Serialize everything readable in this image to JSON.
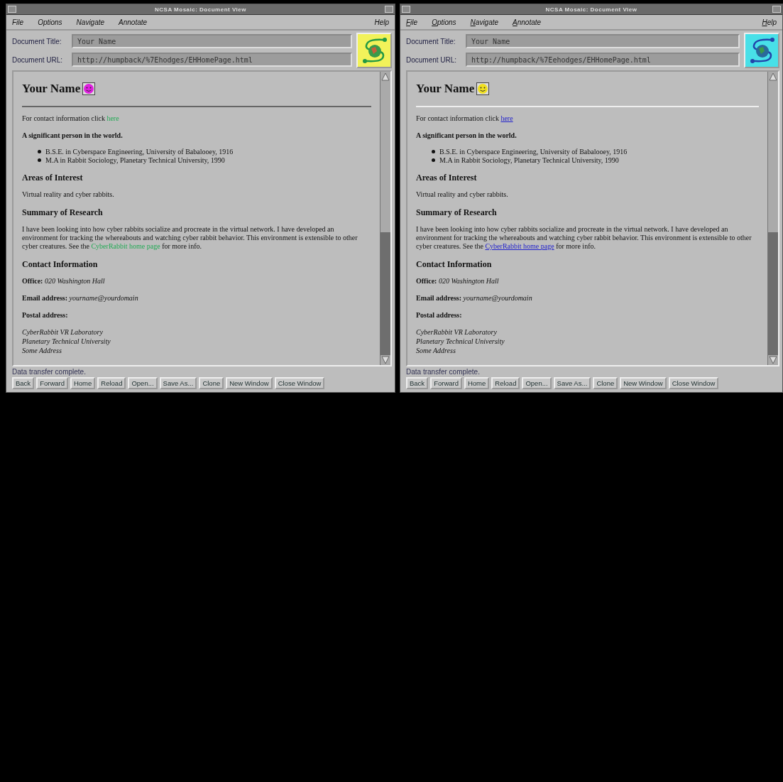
{
  "windows": [
    {
      "title": "NCSA Mosaic: Document View",
      "menu_mnemonics": false,
      "links_underlined": false,
      "menus": [
        {
          "label": "File"
        },
        {
          "label": "Options"
        },
        {
          "label": "Navigate"
        },
        {
          "label": "Annotate"
        }
      ],
      "help": "Help",
      "doc_title_label": "Document Title:",
      "doc_title": "Your Name",
      "doc_url_label": "Document URL:",
      "doc_url": "http://humpback/%7Ehodges/EHHomePage.html",
      "logo": {
        "color": "#f2f25a"
      },
      "content": [
        {
          "kind": "h1",
          "text": "Your Name",
          "color": "#e020e0"
        },
        {
          "kind": "rule"
        },
        {
          "kind": "para",
          "before": "For contact information click ",
          "link": "here"
        },
        {
          "kind": "bold",
          "text": "A significant person in the world."
        },
        {
          "kind": "list",
          "items": [
            "B.S.E. in Cyberspace Engineering, University of Babalooey, 1916",
            "M.A in Rabbit Sociology, Planetary Technical University, 1990"
          ]
        },
        {
          "kind": "h2",
          "text": "Areas of Interest"
        },
        {
          "kind": "para",
          "before": "Virtual reality and cyber rabbits."
        },
        {
          "kind": "h2",
          "text": "Summary of Research"
        },
        {
          "kind": "para",
          "before": "I have been looking into how cyber rabbits socialize and procreate in the virtual network. I have developed an environment for tracking the whereabouts and watching cyber rabbit behavior. This environment is extensible to other cyber creatures. See the ",
          "link": "CyberRabbit home page",
          "after": " for more info."
        },
        {
          "kind": "h2",
          "text": "Contact Information"
        },
        {
          "kind": "rich",
          "text": "**Office:** *020 Washington Hall*"
        },
        {
          "kind": "rich",
          "text": "**Email address:** *yourname@yourdomain*"
        },
        {
          "kind": "bold",
          "text": "Postal address:"
        },
        {
          "kind": "address",
          "lines": [
            "CyberRabbit VR Laboratory",
            "Planetary Technical University",
            "Some Address"
          ]
        }
      ],
      "status": "Data transfer complete.",
      "buttons": [
        "Back",
        "Forward",
        "Home",
        "Reload",
        "Open...",
        "Save As...",
        "Clone",
        "New Window",
        "Close Window"
      ]
    },
    {
      "title": "NCSA Mosaic: Document View",
      "menu_mnemonics": true,
      "links_underlined": true,
      "menus": [
        {
          "label": "File"
        },
        {
          "label": "Options"
        },
        {
          "label": "Navigate"
        },
        {
          "label": "Annotate"
        }
      ],
      "help": "Help",
      "doc_title_label": "Document Title:",
      "doc_title": "Your Name",
      "doc_url_label": "Document URL:",
      "doc_url": "http://humpback/%7Eehodges/EHHomePage.html",
      "logo": {
        "color": "#48e0e8"
      },
      "content": [
        {
          "kind": "h1",
          "text": "Your Name",
          "color": "#f0e020"
        },
        {
          "kind": "rule"
        },
        {
          "kind": "para",
          "before": "For contact information click ",
          "link": "here"
        },
        {
          "kind": "bold",
          "text": "A significant person in the world."
        },
        {
          "kind": "list",
          "items": [
            "B.S.E. in Cyberspace Engineering, University of Babalooey, 1916",
            "M.A in Rabbit Sociology, Planetary Technical University, 1990"
          ]
        },
        {
          "kind": "h2",
          "text": "Areas of Interest"
        },
        {
          "kind": "para",
          "before": "Virtual reality and cyber rabbits."
        },
        {
          "kind": "h2",
          "text": "Summary of Research"
        },
        {
          "kind": "para",
          "before": "I have been looking into how cyber rabbits socialize and procreate in the virtual network. I have developed an environment for tracking the whereabouts and watching cyber rabbit behavior. This environment is extensible to other cyber creatures. See the ",
          "link": "CyberRabbit home page",
          "after": " for more info."
        },
        {
          "kind": "h2",
          "text": "Contact Information"
        },
        {
          "kind": "rich",
          "text": "**Office:** *020 Washington Hall*"
        },
        {
          "kind": "rich",
          "text": "**Email address:** *yourname@yourdomain*"
        },
        {
          "kind": "bold",
          "text": "Postal address:"
        },
        {
          "kind": "address",
          "lines": [
            "CyberRabbit VR Laboratory",
            "Planetary Technical University",
            "Some Address"
          ]
        }
      ],
      "status": "Data transfer complete.",
      "buttons": [
        "Back",
        "Forward",
        "Home",
        "Reload",
        "Open...",
        "Save As...",
        "Clone",
        "New Window",
        "Close Window"
      ]
    }
  ]
}
